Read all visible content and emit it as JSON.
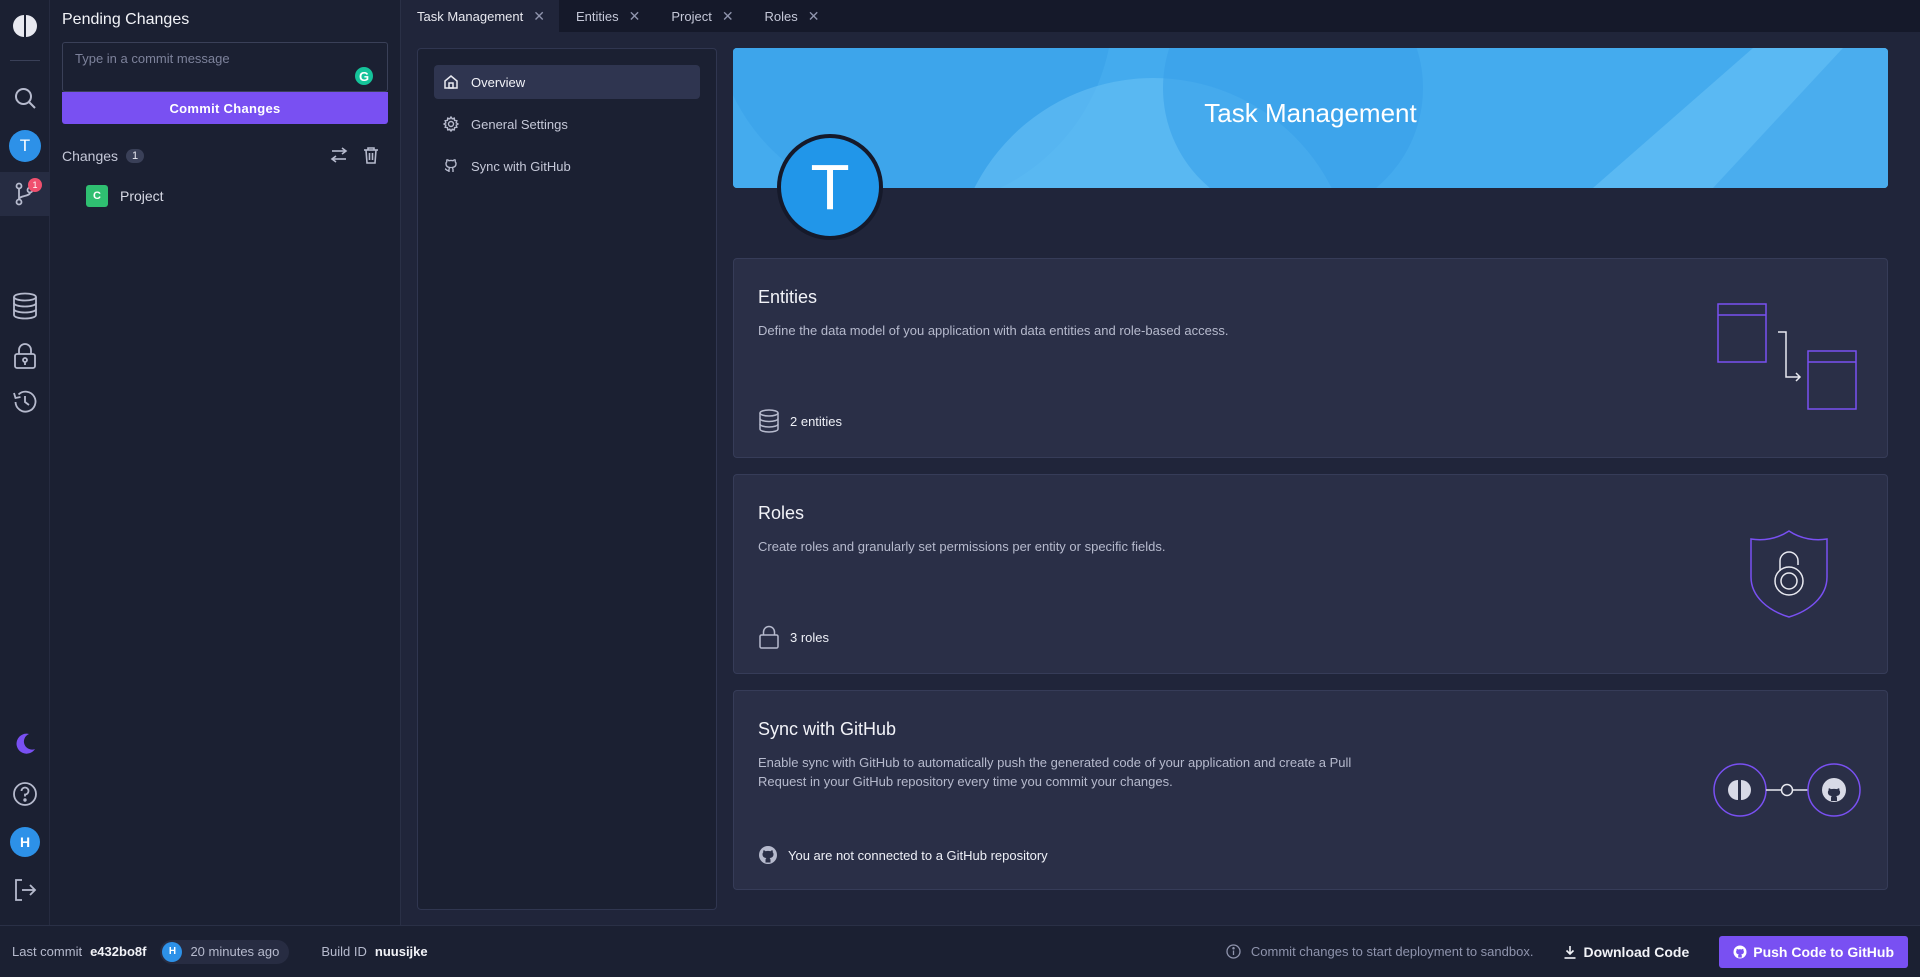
{
  "rail": {
    "user_initial": "T",
    "pending_badge": "1",
    "bottom_user_initial": "H",
    "icons": [
      "app-logo-icon",
      "search-icon",
      "pending-changes-icon",
      "database-icon",
      "lock-icon",
      "history-icon",
      "dark-mode-icon",
      "help-icon",
      "logout-icon"
    ]
  },
  "pending": {
    "title": "Pending Changes",
    "commit_placeholder": "Type in a commit message",
    "commit_button": "Commit Changes",
    "changes_label": "Changes",
    "changes_count": "1",
    "items": [
      {
        "badge": "C",
        "label": "Project"
      }
    ]
  },
  "tabs": [
    {
      "label": "Task Management",
      "active": true
    },
    {
      "label": "Entities"
    },
    {
      "label": "Project"
    },
    {
      "label": "Roles"
    }
  ],
  "nav": {
    "items": [
      {
        "label": "Overview",
        "icon": "home-icon"
      },
      {
        "label": "General Settings",
        "icon": "gear-icon"
      },
      {
        "label": "Sync with GitHub",
        "icon": "github-icon"
      }
    ]
  },
  "app": {
    "name": "Task Management",
    "initial": "T"
  },
  "cards": {
    "entities": {
      "title": "Entities",
      "description": "Define the data model of you application with data entities and role-based access.",
      "footer": "2 entities"
    },
    "roles": {
      "title": "Roles",
      "description": "Create roles and granularly set permissions per entity or specific fields.",
      "footer": "3 roles"
    },
    "github": {
      "title": "Sync with GitHub",
      "description": "Enable sync with GitHub to automatically push the generated code of your application and create a Pull Request in your GitHub repository every time you commit your changes.",
      "footer": "You are not connected to a GitHub repository"
    }
  },
  "status": {
    "last_commit_label": "Last commit",
    "commit_hash": "e432bo8f",
    "user_initial": "H",
    "time_ago": "20 minutes ago",
    "build_label": "Build ID",
    "build_id": "nuusijke",
    "info_text": "Commit changes to start deployment to sandbox.",
    "download_label": "Download Code",
    "push_label": "Push Code to GitHub"
  },
  "colors": {
    "accent": "#7950f2",
    "banner": "#4bb1f1",
    "avatar": "#2196e9",
    "chip_green": "#2fbf71",
    "badge_red": "#f0506e"
  }
}
